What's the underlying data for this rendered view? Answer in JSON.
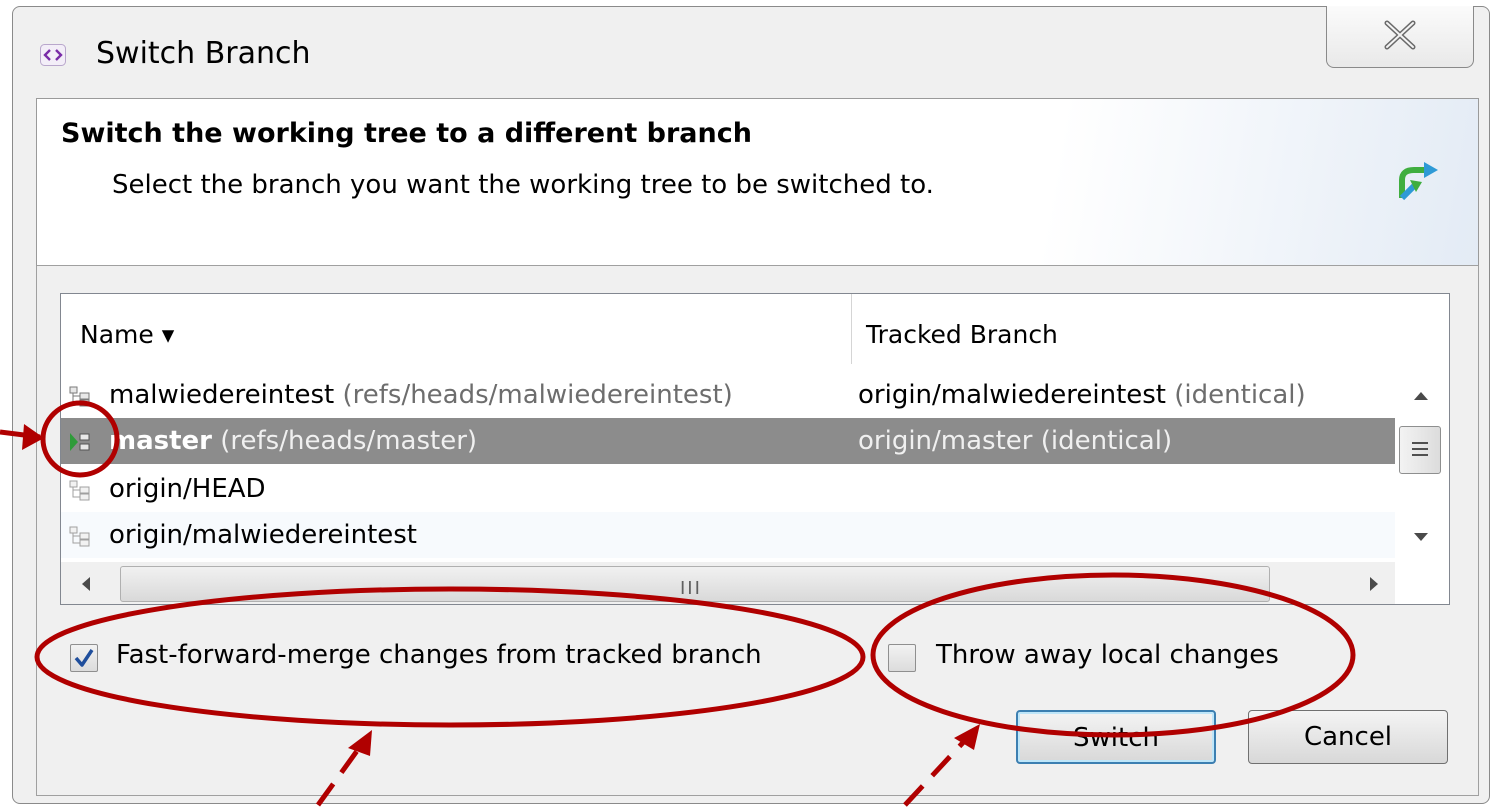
{
  "dialog": {
    "title": "Switch Branch",
    "banner_title": "Switch the working tree to a different branch",
    "banner_description": "Select the branch you want the working tree to be switched to.",
    "title_icon": "eclipse-brackets-icon",
    "banner_icon": "branch-switch-icon",
    "close_icon": "close-icon"
  },
  "table": {
    "columns": [
      "Name ▾",
      "Tracked Branch"
    ],
    "rows": [
      {
        "name": "malwiedereintest",
        "ref": "(refs/heads/malwiedereintest)",
        "tracked": "origin/malwiedereintest",
        "status": "(identical)",
        "selected": false
      },
      {
        "name": "master",
        "ref": "(refs/heads/master)",
        "tracked": "origin/master",
        "status": "(identical)",
        "selected": true
      },
      {
        "name": "origin/HEAD",
        "ref": "",
        "tracked": "",
        "status": "",
        "selected": false
      },
      {
        "name": "origin/malwiedereintest",
        "ref": "",
        "tracked": "",
        "status": "",
        "selected": false
      }
    ],
    "hscroll_grip": "III"
  },
  "options": {
    "fast_forward_label": "Fast-forward-merge changes from tracked branch",
    "fast_forward_checked": true,
    "throw_away_label": "Throw away local changes",
    "throw_away_checked": false
  },
  "buttons": {
    "switch_label": "Switch",
    "cancel_label": "Cancel"
  },
  "colors": {
    "annotation": "#b00000",
    "selection": "#8c8c8c",
    "default_button_border": "#3c7fb1"
  }
}
